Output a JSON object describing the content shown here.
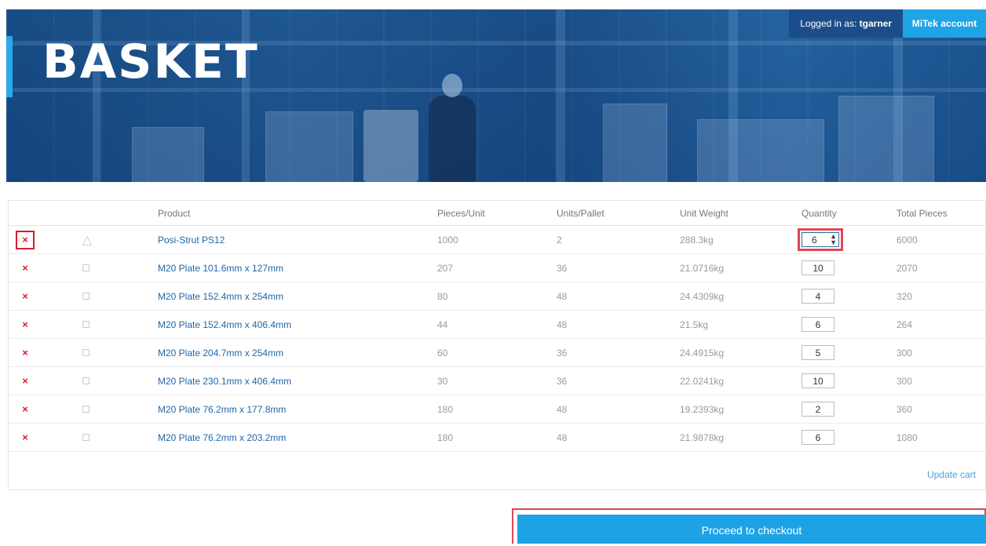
{
  "header": {
    "title": "BASKET",
    "logged_in_label": "Logged in as:",
    "username": "tgarner",
    "account_link": "MiTek account"
  },
  "table": {
    "columns": [
      "",
      "",
      "Product",
      "Pieces/Unit",
      "Units/Pallet",
      "Unit Weight",
      "Quantity",
      "Total Pieces"
    ],
    "rows": [
      {
        "product": "Posi-Strut PS12",
        "pieces_per_unit": "1000",
        "units_per_pallet": "2",
        "unit_weight": "288.3kg",
        "quantity": "6",
        "total_pieces": "6000"
      },
      {
        "product": "M20 Plate 101.6mm x 127mm",
        "pieces_per_unit": "207",
        "units_per_pallet": "36",
        "unit_weight": "21.0716kg",
        "quantity": "10",
        "total_pieces": "2070"
      },
      {
        "product": "M20 Plate 152.4mm x 254mm",
        "pieces_per_unit": "80",
        "units_per_pallet": "48",
        "unit_weight": "24.4309kg",
        "quantity": "4",
        "total_pieces": "320"
      },
      {
        "product": "M20 Plate 152.4mm x 406.4mm",
        "pieces_per_unit": "44",
        "units_per_pallet": "48",
        "unit_weight": "21.5kg",
        "quantity": "6",
        "total_pieces": "264"
      },
      {
        "product": "M20 Plate 204.7mm x 254mm",
        "pieces_per_unit": "60",
        "units_per_pallet": "36",
        "unit_weight": "24.4915kg",
        "quantity": "5",
        "total_pieces": "300"
      },
      {
        "product": "M20 Plate 230.1mm x 406.4mm",
        "pieces_per_unit": "30",
        "units_per_pallet": "36",
        "unit_weight": "22.0241kg",
        "quantity": "10",
        "total_pieces": "300"
      },
      {
        "product": "M20 Plate 76.2mm x 177.8mm",
        "pieces_per_unit": "180",
        "units_per_pallet": "48",
        "unit_weight": "19.2393kg",
        "quantity": "2",
        "total_pieces": "360"
      },
      {
        "product": "M20 Plate 76.2mm x 203.2mm",
        "pieces_per_unit": "180",
        "units_per_pallet": "48",
        "unit_weight": "21.9878kg",
        "quantity": "6",
        "total_pieces": "1080"
      }
    ]
  },
  "actions": {
    "remove_glyph": "×",
    "update_cart": "Update cart",
    "checkout": "Proceed to checkout"
  },
  "colors": {
    "accent": "#1ea2e6",
    "remove": "#e0192b",
    "link": "#2167a8",
    "highlight": "#e24553"
  },
  "icons": {
    "remove": "close-icon",
    "strut_thumb": "posi-strut-icon",
    "plate_thumb": "plate-thumbnail-icon",
    "spinner": "number-spinner-icon"
  }
}
